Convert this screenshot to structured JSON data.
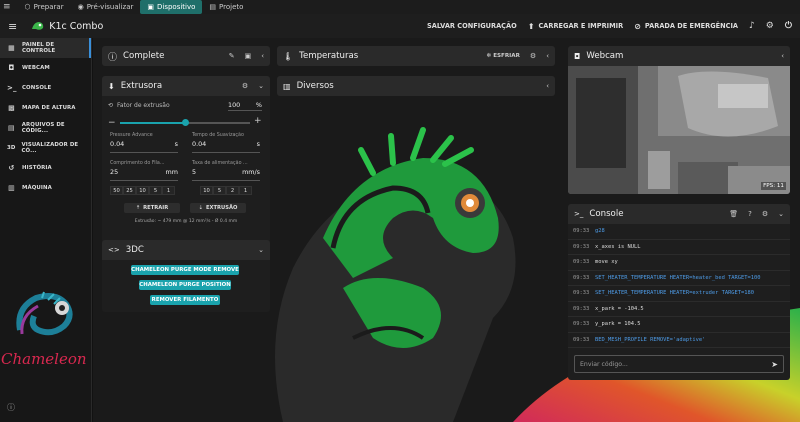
{
  "topbar": {
    "tabs": [
      {
        "label": "Preparar",
        "icon": "cube-icon"
      },
      {
        "label": "Pré-visualizar",
        "icon": "eye-icon"
      },
      {
        "label": "Dispositivo",
        "icon": "printer-icon",
        "active": true
      },
      {
        "label": "Projeto",
        "icon": "folder-icon"
      }
    ]
  },
  "app": {
    "title": "K1c Combo",
    "actions": {
      "save": "SALVAR CONFIGURAÇÃO",
      "upload": "CARREGAR E IMPRIMIR",
      "emergency": "PARADA DE EMERGÊNCIA"
    }
  },
  "sidebar": {
    "items": [
      {
        "label": "PAINEL DE CONTROLE",
        "icon": "dashboard-icon",
        "active": true
      },
      {
        "label": "WEBCAM",
        "icon": "camera-icon"
      },
      {
        "label": "CONSOLE",
        "icon": "terminal-icon"
      },
      {
        "label": "MAPA DE ALTURA",
        "icon": "grid-icon"
      },
      {
        "label": "ARQUIVOS DE CÓDIG...",
        "icon": "file-icon"
      },
      {
        "label": "VISUALIZADOR DE CÓ...",
        "icon": "viewer-3d-icon",
        "prefix": "3D"
      },
      {
        "label": "HISTÓRIA",
        "icon": "history-icon"
      },
      {
        "label": "MÁQUINA",
        "icon": "machine-icon"
      }
    ],
    "logo_text": "Chameleon"
  },
  "status": {
    "title": "Complete"
  },
  "temps": {
    "title": "Temperaturas",
    "cool": "ESFRIAR"
  },
  "misc": {
    "title": "Diversos"
  },
  "extruder": {
    "title": "Extrusora",
    "factor_label": "Fator de extrusão",
    "factor_value": "100",
    "factor_unit": "%",
    "factor_fraction": 0.5,
    "pa_label": "Pressure Advance",
    "pa_value": "0.04",
    "pa_unit": "s",
    "smooth_label": "Tempo de Suavização",
    "smooth_value": "0.04",
    "smooth_unit": "s",
    "len_label": "Comprimento do Fila...",
    "len_value": "25",
    "len_unit": "mm",
    "rate_label": "Taxa de alimentação ...",
    "rate_value": "5",
    "rate_unit": "mm/s",
    "len_steps": [
      "50",
      "25",
      "10",
      "5",
      "1"
    ],
    "rate_steps": [
      "10",
      "5",
      "2",
      "1"
    ],
    "retract": "RETRAIR",
    "extrude": "EXTRUSÃO",
    "info": "Extrusão: ~ 479 mm @ 12 mm³/s - Ø 0.4 mm"
  },
  "threedc": {
    "title": "3DC",
    "buttons": [
      "CHAMELEON PURGE MODE REMOVE",
      "CHAMELEON PURGE POSITION",
      "REMOVER FILAMENTO"
    ]
  },
  "webcam": {
    "title": "Webcam",
    "fps": "FPS: 11"
  },
  "console": {
    "title": "Console",
    "placeholder": "Enviar código...",
    "rows": [
      {
        "time": "09:33",
        "msg": "g28",
        "blue": true
      },
      {
        "time": "09:33",
        "msg": "x_axes is NULL",
        "blue": false
      },
      {
        "time": "09:33",
        "msg": "move xy",
        "blue": false
      },
      {
        "time": "09:33",
        "msg": "SET_HEATER_TEMPERATURE HEATER=heater_bed TARGET=100",
        "blue": true
      },
      {
        "time": "09:33",
        "msg": "SET_HEATER_TEMPERATURE HEATER=extruder TARGET=180",
        "blue": true
      },
      {
        "time": "09:33",
        "msg": "x_park = -104.5",
        "blue": false
      },
      {
        "time": "09:33",
        "msg": "y_park = 104.5",
        "blue": false
      },
      {
        "time": "09:33",
        "msg": "BED_MESH_PROFILE REMOVE='adaptive'",
        "blue": true
      }
    ]
  },
  "colors": {
    "accent": "#1aa3ad",
    "green": "#1f9a3c",
    "blue": "#3a8fd9"
  }
}
